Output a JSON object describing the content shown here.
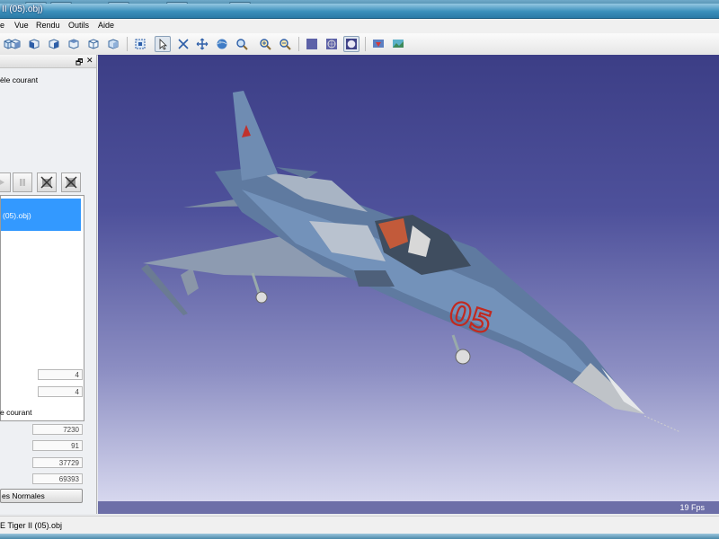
{
  "window": {
    "title": "II (05).obj)"
  },
  "menu": {
    "items": [
      "e",
      "Vue",
      "Rendu",
      "Outils",
      "Aide"
    ]
  },
  "toolbar": {
    "buttons": [
      "cube-front-icon",
      "cube-back-icon",
      "cube-left-icon",
      "cube-right-icon",
      "cube-top-icon",
      "cube-bottom-icon",
      "cube-iso-icon",
      "fit-all-icon",
      "select-icon",
      "rotate-icon",
      "pan-icon",
      "orbit-icon",
      "zoom-region-icon",
      "zoom-in-icon",
      "zoom-out-icon",
      "flat-shading-icon",
      "wireframe-icon",
      "smooth-shading-icon",
      "lighting-icon",
      "texture-icon"
    ]
  },
  "panel": {
    "current_model_label": "èle courant",
    "list_selected_item": "(05).obj)",
    "count_a": "4",
    "count_b": "4",
    "mesh_section_label": "e courant",
    "stat_1": "7230",
    "stat_2": "91",
    "stat_3": "37729",
    "stat_4": "69393",
    "normals_button": "es Normales"
  },
  "viewport": {
    "fps": "19 Fps",
    "aircraft_number": "05",
    "background_top": "#3c3e86",
    "background_bottom": "#d6d7ee"
  },
  "status": {
    "filename": "E Tiger II (05).obj"
  }
}
